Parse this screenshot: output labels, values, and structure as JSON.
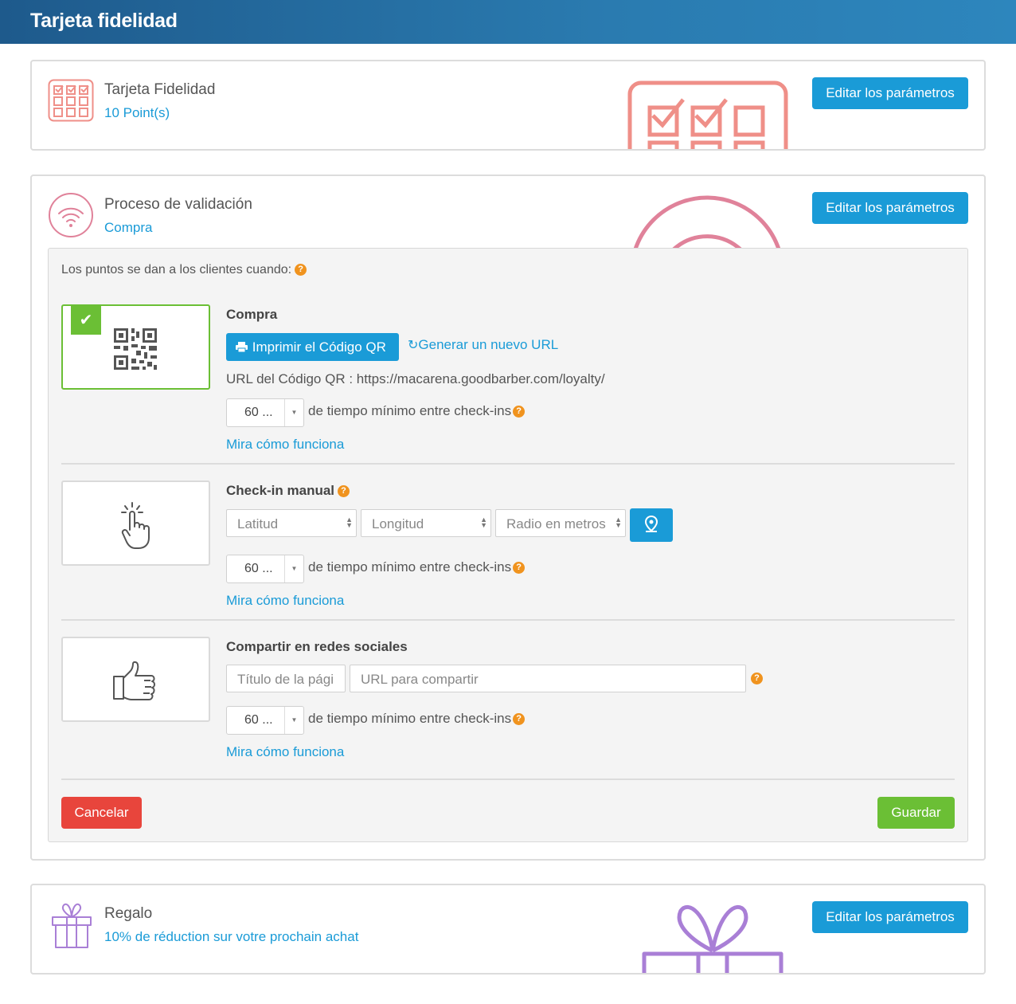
{
  "header": {
    "title": "Tarjeta fidelidad"
  },
  "loyalty_card": {
    "title": "Tarjeta Fidelidad",
    "subtitle": "10 Point(s)",
    "edit_label": "Editar los parámetros",
    "icon": "checkbox-grid-icon",
    "accent": "#ef8f88"
  },
  "validation": {
    "title": "Proceso de validación",
    "subtitle": "Compra",
    "edit_label": "Editar los parámetros",
    "icon": "wifi-signal-icon",
    "accent": "#e0829a",
    "panel": {
      "intro": "Los puntos se dan a los clientes cuando:",
      "options": [
        {
          "title": "Compra",
          "active": true,
          "icon": "qr-code-icon",
          "print_label": "Imprimir el Código QR",
          "generate_label": "Generar un nuevo URL",
          "url_text": "URL del Código QR : https://macarena.goodbarber.com/loyalty/",
          "interval_value": "60 ...",
          "interval_text": "de tiempo mínimo entre check-ins",
          "how_link": "Mira cómo funciona"
        },
        {
          "title": "Check-in manual",
          "active": false,
          "icon": "tap-hand-icon",
          "lat_placeholder": "Latitud",
          "lng_placeholder": "Longitud",
          "radius_placeholder": "Radio en metros",
          "interval_value": "60 ...",
          "interval_text": "de tiempo mínimo entre check-ins",
          "how_link": "Mira cómo funciona"
        },
        {
          "title": "Compartir en redes sociales",
          "active": false,
          "icon": "thumbs-up-icon",
          "page_title_placeholder": "Título de la pági",
          "share_url_placeholder": "URL para compartir",
          "interval_value": "60 ...",
          "interval_text": "de tiempo mínimo entre check-ins",
          "how_link": "Mira cómo funciona"
        }
      ],
      "cancel_label": "Cancelar",
      "save_label": "Guardar"
    }
  },
  "gift": {
    "title": "Regalo",
    "subtitle": "10% de réduction sur votre prochain achat",
    "edit_label": "Editar los parámetros",
    "icon": "gift-icon",
    "accent": "#a97fd6"
  },
  "colors": {
    "primary": "#1a9bd7",
    "success": "#6bbf35",
    "danger": "#e8453c",
    "help": "#f0931e"
  }
}
